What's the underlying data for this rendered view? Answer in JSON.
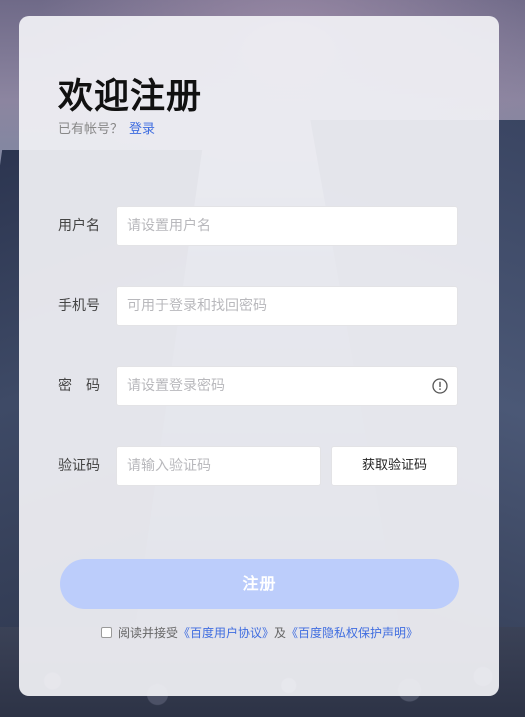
{
  "page": {
    "title": "欢迎注册",
    "have_account_text": "已有帐号？",
    "login_link": "登录"
  },
  "form": {
    "username": {
      "label": "用户名",
      "placeholder": "请设置用户名",
      "value": ""
    },
    "phone": {
      "label": "手机号",
      "placeholder": "可用于登录和找回密码",
      "value": ""
    },
    "password": {
      "label": "密　码",
      "placeholder": "请设置登录密码",
      "value": "",
      "icon": "info-circle-icon"
    },
    "code": {
      "label": "验证码",
      "placeholder": "请输入验证码",
      "value": "",
      "button_label": "获取验证码"
    }
  },
  "submit": {
    "label": "注册",
    "color": "#bccdfb"
  },
  "agreement": {
    "prefix": "阅读并接受",
    "user_agreement": "《百度用户协议》",
    "and": "及",
    "privacy_statement": "《百度隐私权保护声明》",
    "checked": false
  },
  "colors": {
    "accent": "#3f6de0"
  }
}
